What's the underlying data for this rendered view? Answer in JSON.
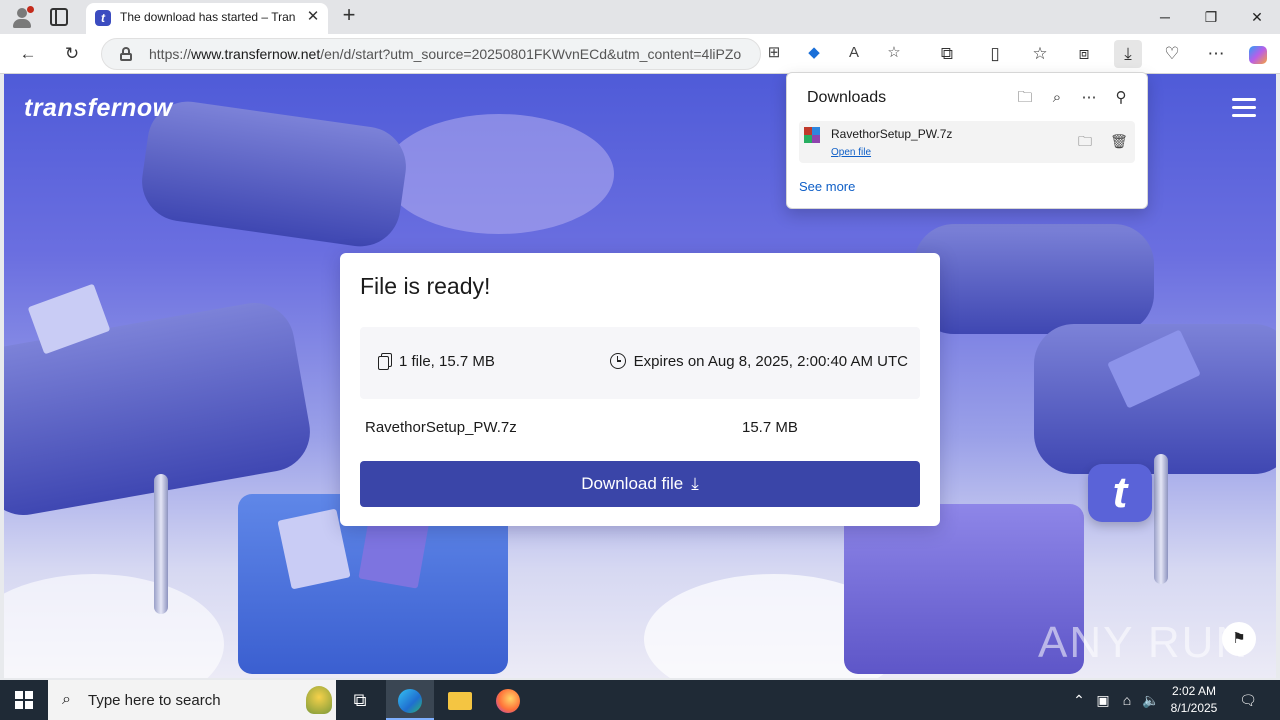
{
  "browser": {
    "tab_title": "The download has started – TransferNow",
    "new_tab_label": "+",
    "url_host": "www.transfernow.net",
    "url_prefix": "https://",
    "url_path": "/en/d/start?utm_source=20250801FKWvnECd&utm_content=4liPZo"
  },
  "page": {
    "logo": "transfernow",
    "card_title": "File is ready!",
    "file_summary": "1 file, 15.7 MB",
    "expires": "Expires on Aug 8, 2025, 2:00:40 AM UTC",
    "file_name": "RavethorSetup_PW.7z",
    "file_size": "15.7 MB",
    "download_button": "Download file",
    "badge_letter": "t",
    "watermark": "ANY RUN"
  },
  "downloads_panel": {
    "title": "Downloads",
    "item_name": "RavethorSetup_PW.7z",
    "item_action": "Open file",
    "see_more": "See more"
  },
  "taskbar": {
    "search_placeholder": "Type here to search",
    "time": "2:02 AM",
    "date": "8/1/2025"
  },
  "colors": {
    "accent_button": "#3a45a8",
    "link": "#0f5fc7",
    "page_bg": "#4f5bd8",
    "taskbar": "#1f2a36"
  }
}
